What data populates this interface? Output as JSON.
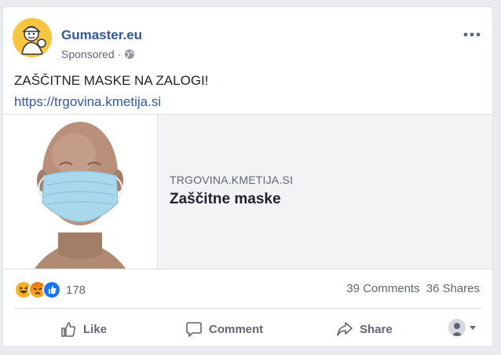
{
  "post": {
    "page_name": "Gumaster.eu",
    "sponsored": "Sponsored",
    "meta_sep": "·",
    "text": "ZAŠČITNE MASKE NA ZALOGI!",
    "link": "https://trgovina.kmetija.si"
  },
  "preview": {
    "domain": "TRGOVINA.KMETIJA.SI",
    "title": "Zaščitne maske"
  },
  "engagement": {
    "reaction_count": "178",
    "comments": "39 Comments",
    "shares": "36 Shares"
  },
  "actions": {
    "like": "Like",
    "comment": "Comment",
    "share": "Share"
  },
  "colors": {
    "brand_link": "#365899",
    "muted": "#606770",
    "avatar_bg": "#f6c643"
  },
  "icons": [
    "globe-icon",
    "more-options-icon",
    "haha-reaction-icon",
    "angry-reaction-icon",
    "like-reaction-icon",
    "like-icon",
    "comment-icon",
    "share-icon",
    "dropdown-caret-icon"
  ]
}
